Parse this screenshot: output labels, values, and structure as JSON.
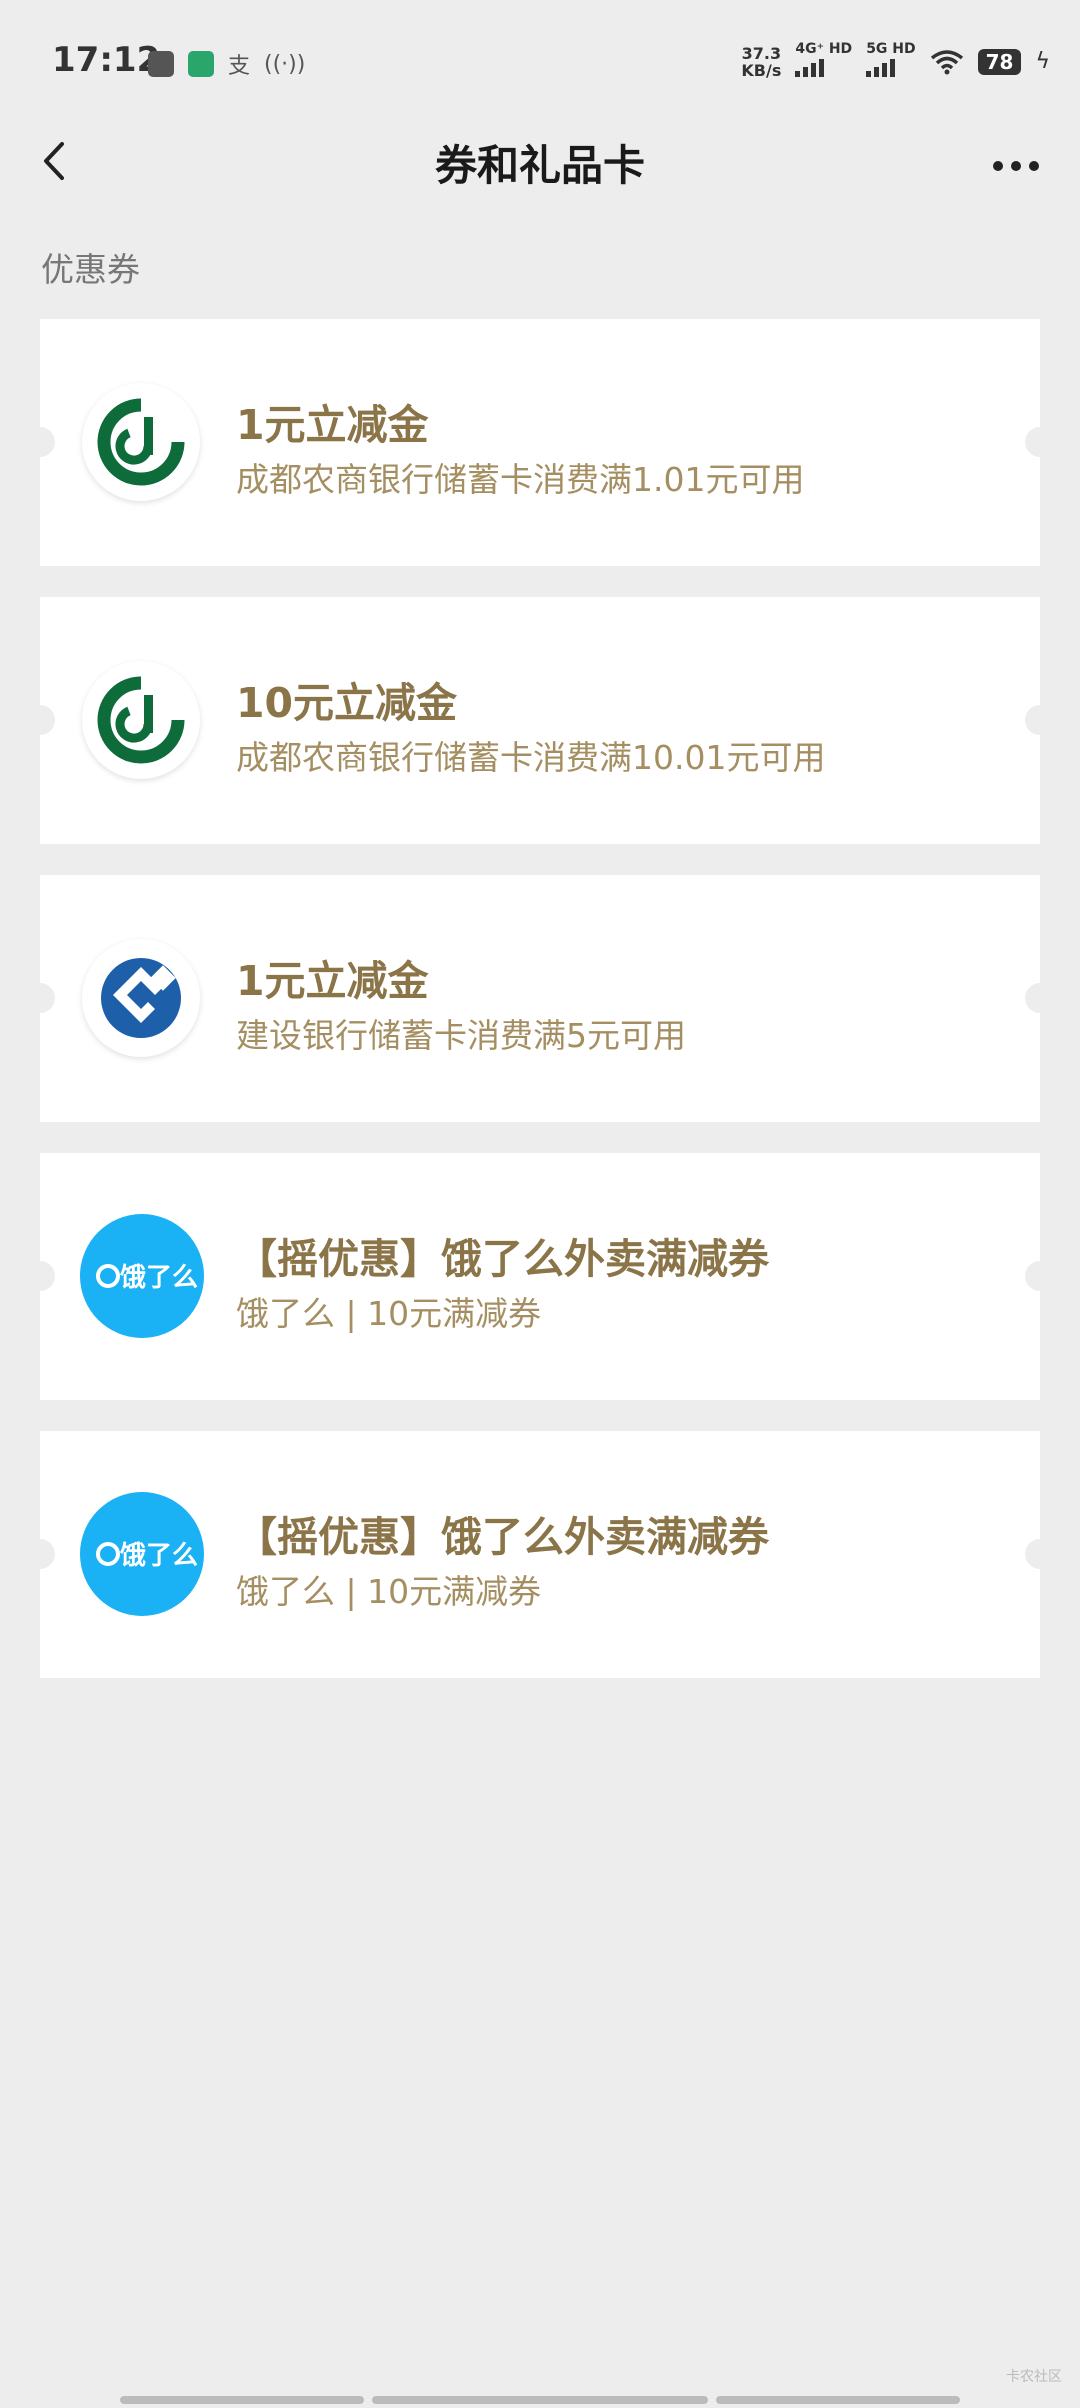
{
  "status_bar": {
    "time": "17:12",
    "left_icons": [
      "app-icon",
      "app-icon-green"
    ],
    "left_text_icon": "支",
    "speed_value": "37.3",
    "speed_unit": "KB/s",
    "net1": "4G⁺ HD",
    "net2": "5G HD",
    "battery": "78"
  },
  "nav": {
    "title": "券和礼品卡",
    "back_icon": "chevron-left-icon",
    "more_icon": "more-icon"
  },
  "section_label": "优惠券",
  "coupons": [
    {
      "title": "1元立减金",
      "desc": "成都农商银行储蓄卡消费满1.01元可用",
      "logo": "chengdu-rural-bank-logo"
    },
    {
      "title": "10元立减金",
      "desc": "成都农商银行储蓄卡消费满10.01元可用",
      "logo": "chengdu-rural-bank-logo"
    },
    {
      "title": "1元立减金",
      "desc": "建设银行储蓄卡消费满5元可用",
      "logo": "ccb-logo"
    },
    {
      "title": "【摇优惠】饿了么外卖满减券",
      "desc": "饿了么 | 10元满减券",
      "logo": "eleme-logo",
      "logo_text": "饿了么"
    },
    {
      "title": "【摇优惠】饿了么外卖满减券",
      "desc": "饿了么 | 10元满减券",
      "logo": "eleme-logo",
      "logo_text": "饿了么"
    }
  ],
  "colors": {
    "background": "#ededed",
    "title_gold": "#8a7448",
    "desc_gold": "#a58f62",
    "crcb_green": "#0e6b3a",
    "ccb_blue": "#1d5fa8",
    "eleme_blue": "#1ab1f5"
  },
  "watermark": "卡农社区"
}
